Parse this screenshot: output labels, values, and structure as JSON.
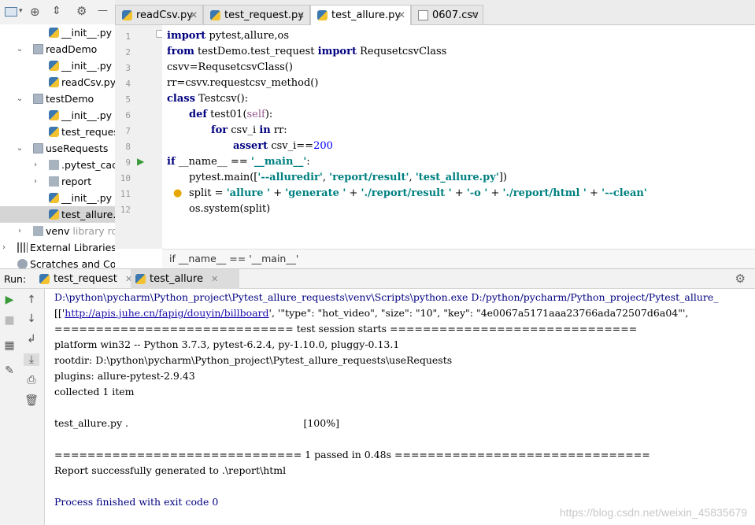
{
  "project_tree": [
    {
      "label": "__init__.py",
      "type": "py",
      "indent": 1
    },
    {
      "label": "readDemo",
      "type": "folder",
      "expanded": true
    },
    {
      "label": "__init__.py",
      "type": "py",
      "indent": 1
    },
    {
      "label": "readCsv.py",
      "type": "py",
      "indent": 1
    },
    {
      "label": "testDemo",
      "type": "folder",
      "expanded": true
    },
    {
      "label": "__init__.py",
      "type": "py",
      "indent": 1
    },
    {
      "label": "test_request",
      "type": "py",
      "indent": 1
    },
    {
      "label": "useRequests",
      "type": "folder",
      "expanded": true
    },
    {
      "label": ".pytest_cache",
      "type": "folder",
      "indent": 1,
      "expanded": false
    },
    {
      "label": "report",
      "type": "folder",
      "indent": 1,
      "expanded": false
    },
    {
      "label": "__init__.py",
      "type": "py",
      "indent": 1
    },
    {
      "label": "test_allure.p",
      "type": "py",
      "indent": 1,
      "selected": true
    },
    {
      "label": "venv",
      "suffix": "library roo",
      "type": "folder",
      "expanded": false
    },
    {
      "label": "External Libraries",
      "type": "lib",
      "expanded": false
    },
    {
      "label": "Scratches and Con",
      "type": "scratch"
    }
  ],
  "editor_tabs": [
    {
      "label": "readCsv.py",
      "active": false
    },
    {
      "label": "test_request.py",
      "active": false
    },
    {
      "label": "test_allure.py",
      "active": true
    },
    {
      "label": "0607.csv",
      "active": false
    }
  ],
  "line_numbers": [
    "1",
    "2",
    "3",
    "4",
    "5",
    "6",
    "7",
    "8",
    "9",
    "10",
    "11",
    "12"
  ],
  "code": {
    "l1_kw": "import",
    "l1_rest": " pytest,allure,os",
    "l2_kw1": "from",
    "l2_mid": " testDemo.test_request ",
    "l2_kw2": "import",
    "l2_rest": " RequsetcsvClass",
    "l3": "csvv=RequsetcsvClass()",
    "l4": "rr=csvv.requestcsv_method()",
    "l5_kw": "class",
    "l5_rest": " Testcsv():",
    "l6_kw": "def",
    "l6_name": " test01(",
    "l6_self": "self",
    "l6_end": "):",
    "l7_kw1": "for",
    "l7_mid": " csv_i ",
    "l7_kw2": "in",
    "l7_rest": " rr:",
    "l8_kw": "assert",
    "l8_mid": " csv_i==",
    "l8_num": "200",
    "l9_kw": "if",
    "l9_mid": " __name__ == ",
    "l9_str": "'__main__'",
    "l9_end": ":",
    "l10_a": "pytest.main([",
    "l10_s1": "'--alluredir'",
    "l10_c1": ", ",
    "l10_s2": "'report/result'",
    "l10_c2": ", ",
    "l10_s3": "'test_allure.py'",
    "l10_end": "])",
    "l11_a": "split = ",
    "l11_s1": "'allure '",
    "l11_p1": " + ",
    "l11_s2": "'generate '",
    "l11_p2": " + ",
    "l11_s3": "'./report/result '",
    "l11_p3": " + ",
    "l11_s4": "'-o '",
    "l11_p4": " + ",
    "l11_s5": "'./report/html '",
    "l11_p5": " + ",
    "l11_s6": "'--clean'",
    "l12": "os.system(split)"
  },
  "breadcrumb": "if __name__ == '__main__'",
  "run_label": "Run:",
  "run_tabs": [
    {
      "label": "test_request",
      "active": false
    },
    {
      "label": "test_allure",
      "active": true
    }
  ],
  "console": [
    "D:\\python\\pycharm\\Python_project\\Pytest_allure_requests\\venv\\Scripts\\python.exe D:/python/pycharm/Python_project/Pytest_allure_",
    "[['",
    "============================= test session starts ==============================",
    "platform win32 -- Python 3.7.3, pytest-6.2.4, py-1.10.0, pluggy-0.13.1",
    "rootdir: D:\\python\\pycharm\\Python_project\\Pytest_allure_requests\\useRequests",
    "plugins: allure-pytest-2.9.43",
    "collected 1 item",
    "test_allure.py .                                                        [100%]",
    "============================== 1 passed in 0.48s ===============================",
    "Report successfully generated to .\\report\\html",
    "Process finished with exit code 0"
  ],
  "console_link": "http://apis.juhe.cn/fapig/douyin/billboard",
  "console_line2_rest": "', '\"type\": \"hot_video\", \"size\": \"10\", \"key\": \"4e0067a5171aaa23766ada72507d6a04\"',",
  "watermark": "https://blog.csdn.net/weixin_45835679"
}
